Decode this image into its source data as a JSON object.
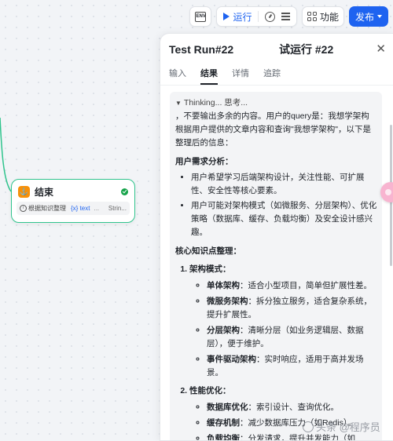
{
  "toolbar": {
    "env_label": "ENV",
    "run_label": "运行",
    "feature_label": "功能",
    "publish_label": "发布"
  },
  "end_node": {
    "title": "结束",
    "var_name": "根据知识整理",
    "var_type": "{x} text",
    "var_ellipsis": "...",
    "var_kind": "Strin..."
  },
  "panel": {
    "title": "Test Run#22",
    "title_cn": "试运行 #22",
    "tabs": [
      "输入",
      "结果",
      "详情",
      "追踪"
    ],
    "active_tab": "结果"
  },
  "result": {
    "thinking": "Thinking... 思考...",
    "intro": "，不要输出多余的内容。用户的query是：我想学架构根据用户提供的文章内容和查询\"我想学架构\"，以下是整理后的信息：",
    "sec1_title": "用户需求分析：",
    "sec1_items": [
      "用户希望学习后端架构设计，关注性能、可扩展性、安全性等核心要素。",
      "用户可能对架构模式（如微服务、分层架构）、优化策略（数据库、缓存、负载均衡）及安全设计感兴趣。"
    ],
    "sec2_title": "核心知识点整理：",
    "subsections": [
      {
        "title": "架构模式：",
        "items": [
          {
            "label": "单体架构",
            "text": "：适合小型项目，简单但扩展性差。"
          },
          {
            "label": "微服务架构",
            "text": "：拆分独立服务，适合复杂系统，提升扩展性。"
          },
          {
            "label": "分层架构",
            "text": "：清晰分层（如业务逻辑层、数据层），便于维护。"
          },
          {
            "label": "事件驱动架构",
            "text": "：实时响应，适用于高并发场景。"
          }
        ]
      },
      {
        "title": "性能优化：",
        "items": [
          {
            "label": "数据库优化",
            "text": "：索引设计、查询优化。"
          },
          {
            "label": "缓存机制",
            "text": "：减少数据库压力（如Redis）。"
          },
          {
            "label": "负载均衡",
            "text": "：分发请求，提升并发能力（如Nginx）。"
          }
        ]
      }
    ]
  },
  "watermark": "头条 @程序员"
}
